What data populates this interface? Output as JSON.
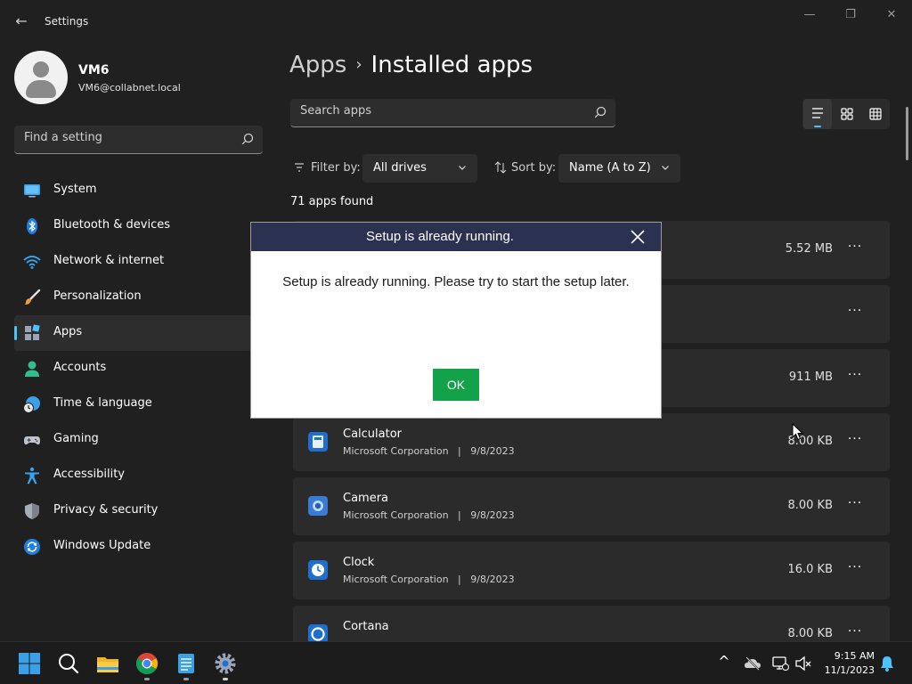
{
  "window": {
    "title": "Settings",
    "back_glyph": "←",
    "minimize_glyph": "—",
    "restore_glyph": "❐",
    "close_glyph": "✕"
  },
  "profile": {
    "name": "VM6",
    "email": "VM6@collabnet.local"
  },
  "find_setting": {
    "placeholder": "Find a setting"
  },
  "sidebar": {
    "items": [
      {
        "label": "System",
        "icon": "system-icon"
      },
      {
        "label": "Bluetooth & devices",
        "icon": "bluetooth-icon"
      },
      {
        "label": "Network & internet",
        "icon": "network-icon"
      },
      {
        "label": "Personalization",
        "icon": "brush-icon"
      },
      {
        "label": "Apps",
        "icon": "apps-icon",
        "active": true
      },
      {
        "label": "Accounts",
        "icon": "accounts-icon"
      },
      {
        "label": "Time & language",
        "icon": "clock-globe-icon"
      },
      {
        "label": "Gaming",
        "icon": "gamepad-icon"
      },
      {
        "label": "Accessibility",
        "icon": "accessibility-icon"
      },
      {
        "label": "Privacy & security",
        "icon": "shield-icon"
      },
      {
        "label": "Windows Update",
        "icon": "update-icon"
      }
    ]
  },
  "header": {
    "crumb_parent": "Apps",
    "crumb_sep": "›",
    "crumb_current": "Installed apps"
  },
  "search_apps": {
    "placeholder": "Search apps"
  },
  "filter": {
    "filter_label": "Filter by:",
    "filter_value": "All drives",
    "sort_label": "Sort by:",
    "sort_value": "Name (A to Z)"
  },
  "apps_count": "71 apps found",
  "apps": [
    {
      "name": "",
      "meta": "",
      "size": "5.52 MB"
    },
    {
      "name": "",
      "meta": "",
      "size": ""
    },
    {
      "name": "",
      "meta": "",
      "size": "911 MB"
    },
    {
      "name": "Calculator",
      "publisher": "Microsoft Corporation",
      "date": "9/8/2023",
      "size": "8.00 KB"
    },
    {
      "name": "Camera",
      "publisher": "Microsoft Corporation",
      "date": "9/8/2023",
      "size": "8.00 KB"
    },
    {
      "name": "Clock",
      "publisher": "Microsoft Corporation",
      "date": "9/8/2023",
      "size": "16.0 KB"
    },
    {
      "name": "Cortana",
      "publisher": "",
      "date": "",
      "size": "8.00 KB"
    }
  ],
  "more_glyph": "···",
  "meta_sep": "|",
  "dialog": {
    "title": "Setup is already running.",
    "message": "Setup is already running. Please try to start the setup later.",
    "ok_label": "OK"
  },
  "taskbar": {
    "time": "9:15 AM",
    "date": "11/1/2023",
    "chevron_glyph": "^"
  },
  "colors": {
    "accent": "#4cc2ff",
    "ok_green": "#13a24a",
    "dialog_title_bg": "#2b3150"
  }
}
